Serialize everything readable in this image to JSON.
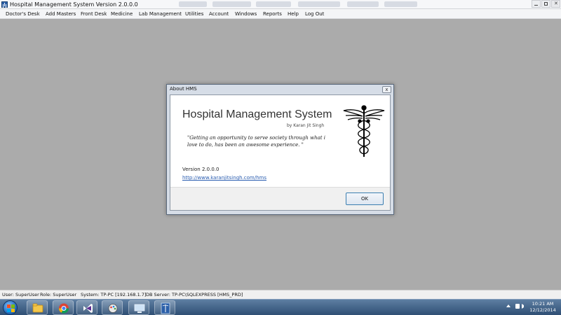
{
  "window": {
    "title": "Hospital Management System Version 2.0.0.0",
    "app_icon": "hospital-app-icon"
  },
  "menu": [
    {
      "label": "Doctor's Desk"
    },
    {
      "label": "Add Masters"
    },
    {
      "label": "Front Desk"
    },
    {
      "label": "Medicine"
    },
    {
      "label": "Lab Management"
    },
    {
      "label": "Utilities"
    },
    {
      "label": "Account"
    },
    {
      "label": "Windows"
    },
    {
      "label": "Reports"
    },
    {
      "label": "Help"
    },
    {
      "label": "Log Out"
    }
  ],
  "about_dialog": {
    "title": "About HMS",
    "close_glyph": "x",
    "app_name": "Hospital Management System",
    "author": "by Karan Jit Singh",
    "quote": "\"Getting an opportunity to serve society through what i love to do, has been an awesome experience. \"",
    "version": "Version 2.0.0.0",
    "url": "http://www.karanjitsingh.com/hms",
    "ok_label": "OK",
    "logo_icon": "caduceus-icon"
  },
  "status_bar": {
    "user": "User: SuperUser",
    "role": "Role: SuperUser",
    "system": "System: TP-PC [192.168.1.7]",
    "db_server": "DB Server: TP-PC\\SQLEXPRESS [HMS_PRD]"
  },
  "taskbar": {
    "pinned": [
      "windows-explorer-icon",
      "chrome-icon",
      "visual-studio-icon",
      "paint-icon",
      "remote-desktop-icon",
      "hms-app-icon"
    ]
  },
  "clock": {
    "time": "10:21 AM",
    "date": "12/12/2014"
  },
  "colors": {
    "workspace": "#ababab",
    "link": "#2a5db0",
    "taskbar": "#2f4f74"
  }
}
